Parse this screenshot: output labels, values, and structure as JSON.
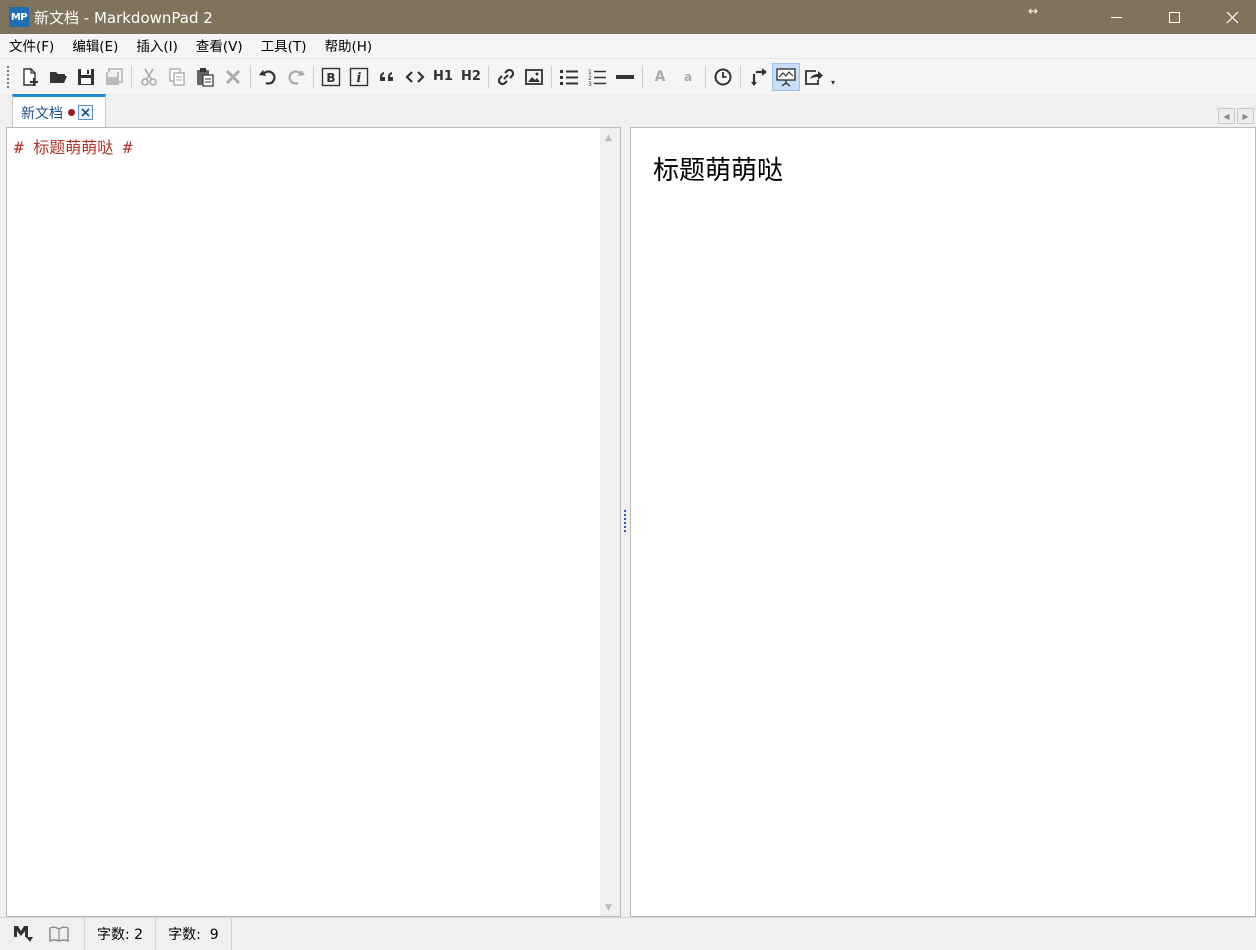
{
  "window": {
    "logo_text": "MP",
    "title": "新文档 - MarkdownPad 2",
    "resize_glyph": "↔"
  },
  "menu": [
    {
      "label": "文件(F)",
      "name": "file"
    },
    {
      "label": "编辑(E)",
      "name": "edit"
    },
    {
      "label": "插入(I)",
      "name": "insert"
    },
    {
      "label": "查看(V)",
      "name": "view"
    },
    {
      "label": "工具(T)",
      "name": "tools"
    },
    {
      "label": "帮助(H)",
      "name": "help"
    }
  ],
  "toolbar": {
    "h1_label": "H1",
    "h2_label": "H2",
    "font_larger_label": "A",
    "font_smaller_label": "a"
  },
  "tab": {
    "label": "新文档"
  },
  "editor": {
    "content": "# 标题萌萌哒 #"
  },
  "preview": {
    "heading": "标题萌萌哒"
  },
  "status": {
    "word_count": "字数: 2",
    "char_count": "字数:  9"
  },
  "colors": {
    "titlebar": "#80735b",
    "tab_accent": "#1f8ad8",
    "editor_text": "#b3332a"
  }
}
